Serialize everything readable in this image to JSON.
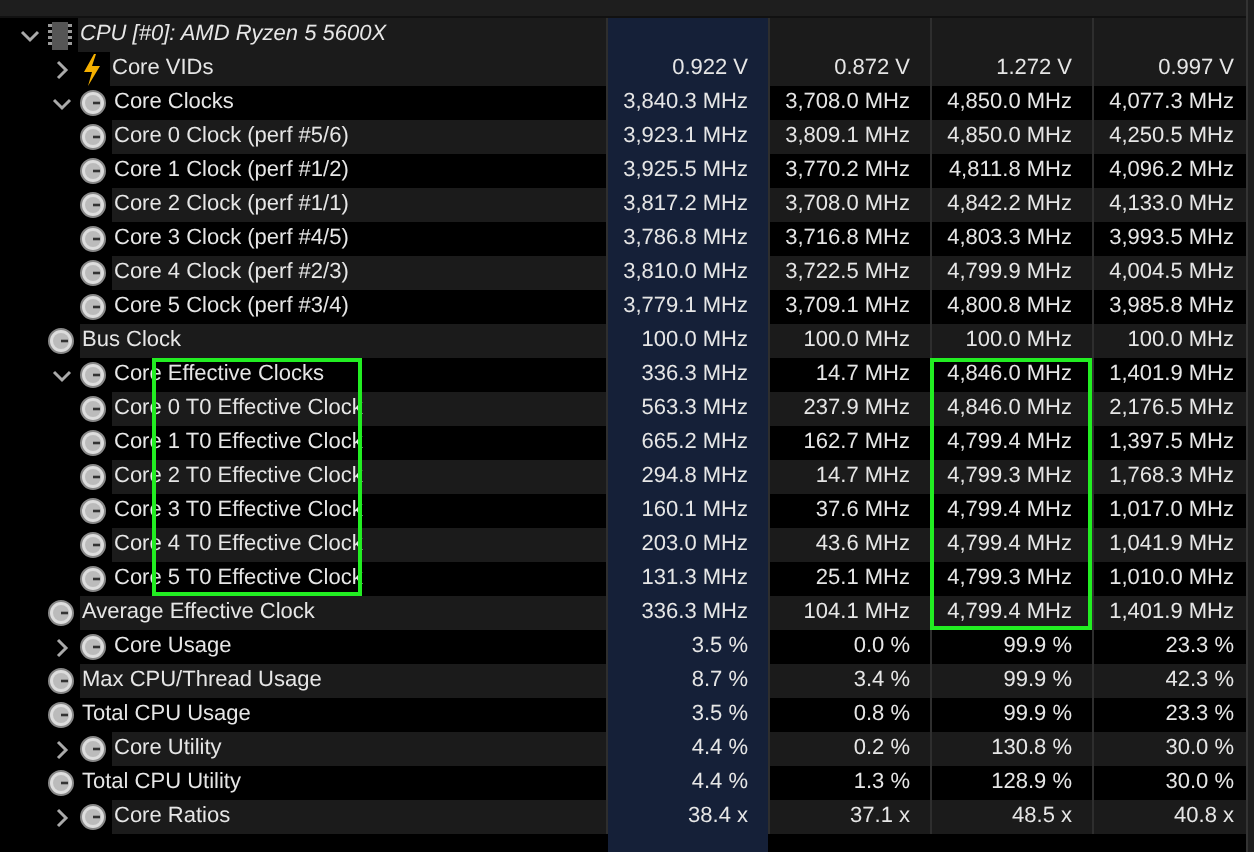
{
  "sensor_tree": {
    "rows": [
      {
        "label": "CPU [#0]: AMD Ryzen 5 5600X",
        "kind": "device",
        "expanded": true,
        "label_marked": false,
        "max_marked": false,
        "children": [
          {
            "label": "Core VIDs",
            "kind": "voltage",
            "expanded": false,
            "label_marked": false,
            "max_marked": false,
            "values": [
              "0.922 V",
              "0.872 V",
              "1.272 V",
              "0.997 V"
            ]
          },
          {
            "label": "Core Clocks",
            "kind": "sensor",
            "expanded": true,
            "label_marked": false,
            "max_marked": false,
            "values": [
              "3,840.3 MHz",
              "3,708.0 MHz",
              "4,850.0 MHz",
              "4,077.3 MHz"
            ],
            "children": [
              {
                "label": "Core 0 Clock (perf #5/6)",
                "kind": "sensor",
                "label_marked": false,
                "max_marked": false,
                "values": [
                  "3,923.1 MHz",
                  "3,809.1 MHz",
                  "4,850.0 MHz",
                  "4,250.5 MHz"
                ]
              },
              {
                "label": "Core 1 Clock (perf #1/2)",
                "kind": "sensor",
                "label_marked": false,
                "max_marked": false,
                "values": [
                  "3,925.5 MHz",
                  "3,770.2 MHz",
                  "4,811.8 MHz",
                  "4,096.2 MHz"
                ]
              },
              {
                "label": "Core 2 Clock (perf #1/1)",
                "kind": "sensor",
                "label_marked": false,
                "max_marked": false,
                "values": [
                  "3,817.2 MHz",
                  "3,708.0 MHz",
                  "4,842.2 MHz",
                  "4,133.0 MHz"
                ]
              },
              {
                "label": "Core 3 Clock (perf #4/5)",
                "kind": "sensor",
                "label_marked": false,
                "max_marked": false,
                "values": [
                  "3,786.8 MHz",
                  "3,716.8 MHz",
                  "4,803.3 MHz",
                  "3,993.5 MHz"
                ]
              },
              {
                "label": "Core 4 Clock (perf #2/3)",
                "kind": "sensor",
                "label_marked": false,
                "max_marked": false,
                "values": [
                  "3,810.0 MHz",
                  "3,722.5 MHz",
                  "4,799.9 MHz",
                  "4,004.5 MHz"
                ]
              },
              {
                "label": "Core 5 Clock (perf #3/4)",
                "kind": "sensor",
                "label_marked": false,
                "max_marked": false,
                "values": [
                  "3,779.1 MHz",
                  "3,709.1 MHz",
                  "4,800.8 MHz",
                  "3,985.8 MHz"
                ]
              }
            ]
          },
          {
            "label": "Bus Clock",
            "kind": "sensor",
            "label_marked": false,
            "max_marked": false,
            "values": [
              "100.0 MHz",
              "100.0 MHz",
              "100.0 MHz",
              "100.0 MHz"
            ]
          },
          {
            "label": "Core Effective Clocks",
            "kind": "sensor",
            "expanded": true,
            "label_marked": true,
            "max_marked": true,
            "values": [
              "336.3 MHz",
              "14.7 MHz",
              "4,846.0 MHz",
              "1,401.9 MHz"
            ],
            "children": [
              {
                "label": "Core 0 T0 Effective Clock",
                "kind": "sensor",
                "label_marked": true,
                "max_marked": true,
                "values": [
                  "563.3 MHz",
                  "237.9 MHz",
                  "4,846.0 MHz",
                  "2,176.5 MHz"
                ]
              },
              {
                "label": "Core 1 T0 Effective Clock",
                "kind": "sensor",
                "label_marked": true,
                "max_marked": true,
                "values": [
                  "665.2 MHz",
                  "162.7 MHz",
                  "4,799.4 MHz",
                  "1,397.5 MHz"
                ]
              },
              {
                "label": "Core 2 T0 Effective Clock",
                "kind": "sensor",
                "label_marked": true,
                "max_marked": true,
                "values": [
                  "294.8 MHz",
                  "14.7 MHz",
                  "4,799.3 MHz",
                  "1,768.3 MHz"
                ]
              },
              {
                "label": "Core 3 T0 Effective Clock",
                "kind": "sensor",
                "label_marked": true,
                "max_marked": true,
                "values": [
                  "160.1 MHz",
                  "37.6 MHz",
                  "4,799.4 MHz",
                  "1,017.0 MHz"
                ]
              },
              {
                "label": "Core 4 T0 Effective Clock",
                "kind": "sensor",
                "label_marked": true,
                "max_marked": true,
                "values": [
                  "203.0 MHz",
                  "43.6 MHz",
                  "4,799.4 MHz",
                  "1,041.9 MHz"
                ]
              },
              {
                "label": "Core 5 T0 Effective Clock",
                "kind": "sensor",
                "label_marked": true,
                "max_marked": true,
                "values": [
                  "131.3 MHz",
                  "25.1 MHz",
                  "4,799.3 MHz",
                  "1,010.0 MHz"
                ]
              }
            ]
          },
          {
            "label": "Average Effective Clock",
            "kind": "sensor",
            "label_marked": false,
            "max_marked": true,
            "values": [
              "336.3 MHz",
              "104.1 MHz",
              "4,799.4 MHz",
              "1,401.9 MHz"
            ]
          },
          {
            "label": "Core Usage",
            "kind": "sensor",
            "expanded": false,
            "label_marked": false,
            "max_marked": false,
            "values": [
              "3.5 %",
              "0.0 %",
              "99.9 %",
              "23.3 %"
            ]
          },
          {
            "label": "Max CPU/Thread Usage",
            "kind": "sensor",
            "label_marked": false,
            "max_marked": false,
            "values": [
              "8.7 %",
              "3.4 %",
              "99.9 %",
              "42.3 %"
            ]
          },
          {
            "label": "Total CPU Usage",
            "kind": "sensor",
            "label_marked": false,
            "max_marked": false,
            "values": [
              "3.5 %",
              "0.8 %",
              "99.9 %",
              "23.3 %"
            ]
          },
          {
            "label": "Core Utility",
            "kind": "sensor",
            "expanded": false,
            "label_marked": false,
            "max_marked": false,
            "values": [
              "4.4 %",
              "0.2 %",
              "130.8 %",
              "30.0 %"
            ]
          },
          {
            "label": "Total CPU Utility",
            "kind": "sensor",
            "label_marked": false,
            "max_marked": false,
            "values": [
              "4.4 %",
              "1.3 %",
              "128.9 %",
              "30.0 %"
            ]
          },
          {
            "label": "Core Ratios",
            "kind": "sensor",
            "expanded": false,
            "label_marked": false,
            "max_marked": false,
            "values": [
              "38.4 x",
              "37.1 x",
              "48.5 x",
              "40.8 x"
            ]
          }
        ]
      }
    ]
  }
}
